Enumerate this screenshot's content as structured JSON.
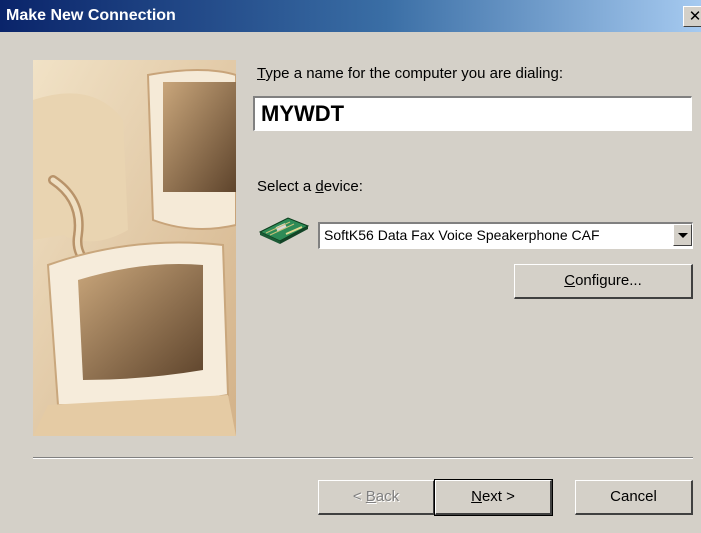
{
  "window": {
    "title": "Make New Connection",
    "close_glyph": "✕"
  },
  "name_prompt": {
    "mnemonic": "T",
    "rest": "ype a name for the computer you are dialing:"
  },
  "name_field": {
    "value": "MYWDT"
  },
  "device_prompt": {
    "before": "Select a ",
    "mnemonic": "d",
    "after": "evice:"
  },
  "device_select": {
    "selected": "SoftK56 Data Fax Voice Speakerphone CAF"
  },
  "configure_button": {
    "mnemonic": "C",
    "rest": "onfigure..."
  },
  "footer": {
    "back": {
      "prefix": "< ",
      "mnemonic": "B",
      "rest": "ack",
      "enabled": false
    },
    "next": {
      "mnemonic": "N",
      "rest": "ext >"
    },
    "cancel": {
      "label": "Cancel"
    }
  },
  "icons": {
    "illustration": "computer-monitors-illustration",
    "device": "modem-card-icon"
  }
}
